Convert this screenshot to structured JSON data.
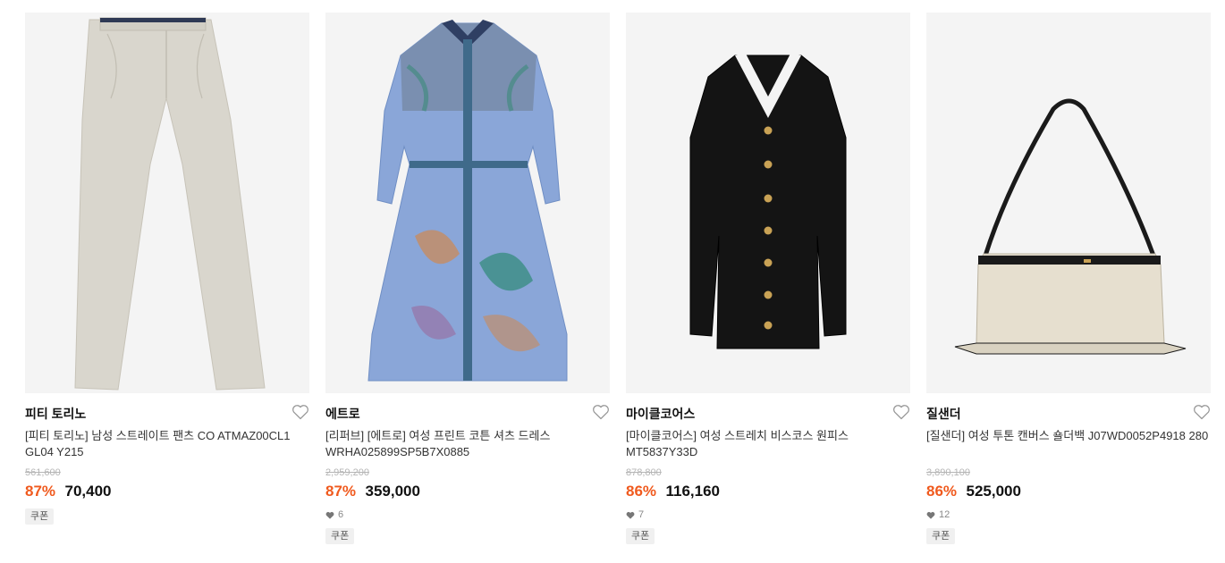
{
  "colors": {
    "discount": "#f05a1e",
    "thumb_bg": "#f4f4f4",
    "strike": "#b5b5b5"
  },
  "products": [
    {
      "brand": "피티 토리노",
      "title": "[피티 토리노] 남성 스트레이트 팬츠 CO ATMAZ00CL1 GL04 Y215",
      "original_price": "561,600",
      "discount_rate": "87%",
      "price": "70,400",
      "likes": "",
      "badge": "쿠폰",
      "image": "beige-chino-pants"
    },
    {
      "brand": "에트로",
      "title": "[리퍼브] [에트로] 여성 프린트 코튼 셔츠 드레스 WRHA025899SP5B7X0885",
      "original_price": "2,959,200",
      "discount_rate": "87%",
      "price": "359,000",
      "likes": "6",
      "badge": "쿠폰",
      "image": "blue-paisley-shirt-dress"
    },
    {
      "brand": "마이클코어스",
      "title": "[마이클코어스] 여성 스트레치 비스코스 원피스 MT5837Y33D",
      "original_price": "878,800",
      "discount_rate": "86%",
      "price": "116,160",
      "likes": "7",
      "badge": "쿠폰",
      "image": "black-knit-dress"
    },
    {
      "brand": "질샌더",
      "title": "[질샌더] 여성 투톤 캔버스 숄더백 J07WD0052P4918 280",
      "original_price": "3,890,100",
      "discount_rate": "86%",
      "price": "525,000",
      "likes": "12",
      "badge": "쿠폰",
      "image": "canvas-shoulder-bag"
    }
  ]
}
